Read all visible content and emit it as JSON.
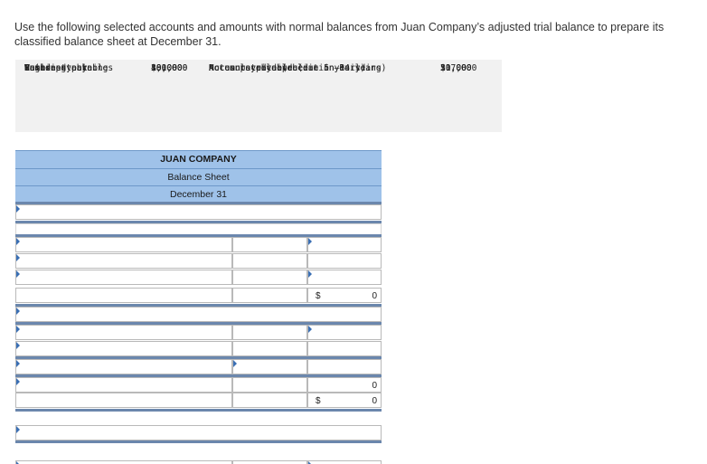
{
  "instructions": "Use the following selected accounts and amounts with normal balances from Juan Company’s adjusted trial balance to prepare its classified balance sheet at December 31.",
  "accounts": {
    "left_names": [
      "Wages payable",
      "Building",
      "Cash",
      "Interest payable",
      "Common stock",
      "Retained earnings"
    ],
    "left_amounts": [
      "$ 1,000",
      "100,000",
      "18,000",
      "2,000",
      "10,000",
      "40,000"
    ],
    "right_names": [
      "Accounts receivable",
      "Accumulated depreciation—Building",
      "Notes payable (due in 5 years)",
      "Notes receivable (due in 14 years)",
      "Accounts payable"
    ],
    "right_amounts": [
      "$ 7,000",
      "30,000",
      "51,000",
      "20,000",
      "11,000"
    ]
  },
  "sheet": {
    "company": "JUAN COMPANY",
    "statement": "Balance Sheet",
    "date": "December 31",
    "currency": "$",
    "total_1": "0",
    "total_2": "0",
    "total_3": "0"
  }
}
